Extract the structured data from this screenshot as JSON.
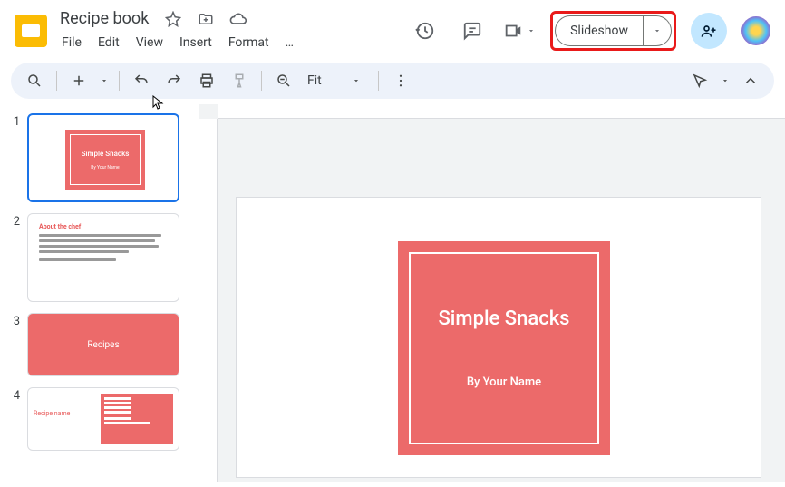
{
  "doc": {
    "title": "Recipe book"
  },
  "menus": {
    "file": "File",
    "edit": "Edit",
    "view": "View",
    "insert": "Insert",
    "format": "Format",
    "more": "…"
  },
  "header": {
    "slideshow": "Slideshow"
  },
  "toolbar": {
    "zoom": "Fit"
  },
  "slides": {
    "s1": {
      "num": "1",
      "title": "Simple Snacks",
      "sub": "By Your Name"
    },
    "s2": {
      "num": "2",
      "title": "About the chef"
    },
    "s3": {
      "num": "3",
      "title": "Recipes"
    },
    "s4": {
      "num": "4",
      "title": "Recipe name"
    }
  },
  "canvas": {
    "title": "Simple Snacks",
    "sub": "By Your Name"
  },
  "colors": {
    "accent": "#ec6a6a",
    "highlight": "#e91a1a",
    "select": "#1a73e8"
  }
}
